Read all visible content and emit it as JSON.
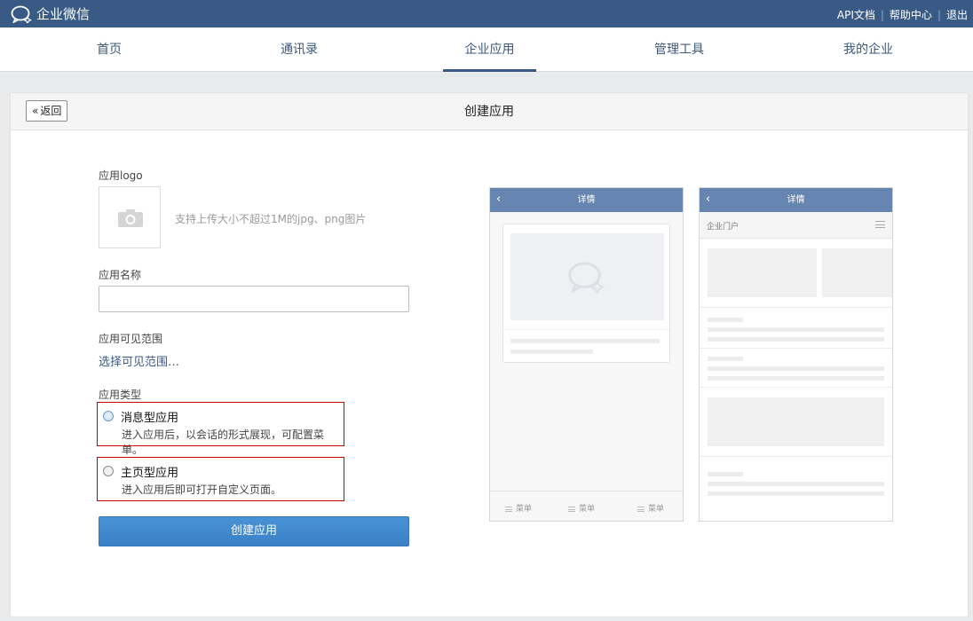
{
  "topbar": {
    "brand": "企业微信",
    "links": [
      "API文档",
      "帮助中心",
      "退出"
    ]
  },
  "nav": {
    "tabs": [
      {
        "label": "首页",
        "active": false
      },
      {
        "label": "通讯录",
        "active": false
      },
      {
        "label": "企业应用",
        "active": true
      },
      {
        "label": "管理工具",
        "active": false
      },
      {
        "label": "我的企业",
        "active": false
      }
    ]
  },
  "page": {
    "back_label": "返回",
    "title": "创建应用"
  },
  "form": {
    "logo_label": "应用logo",
    "logo_hint": "支持上传大小不超过1M的jpg、png图片",
    "name_label": "应用名称",
    "name_value": "",
    "name_placeholder": "",
    "scope_label": "应用可见范围",
    "scope_link": "选择可见范围…",
    "type_label": "应用类型",
    "types": [
      {
        "title": "消息型应用",
        "desc": "进入应用后，以会话的形式展现，可配置菜单。",
        "selected": true
      },
      {
        "title": "主页型应用",
        "desc": "进入应用后即可打开自定义页面。",
        "selected": false
      }
    ],
    "submit_label": "创建应用"
  },
  "preview": {
    "message_app": {
      "header_title": "详情",
      "menu_items": [
        "菜单",
        "菜单",
        "菜单"
      ]
    },
    "home_app": {
      "header_title": "详情",
      "portal_title": "企业门户"
    }
  },
  "colors": {
    "topbar": "#3a5a86",
    "link": "#3a5a86",
    "primary_button": "#3a80c6",
    "highlight_border": "#c80000",
    "phone_header": "#6785b1"
  }
}
